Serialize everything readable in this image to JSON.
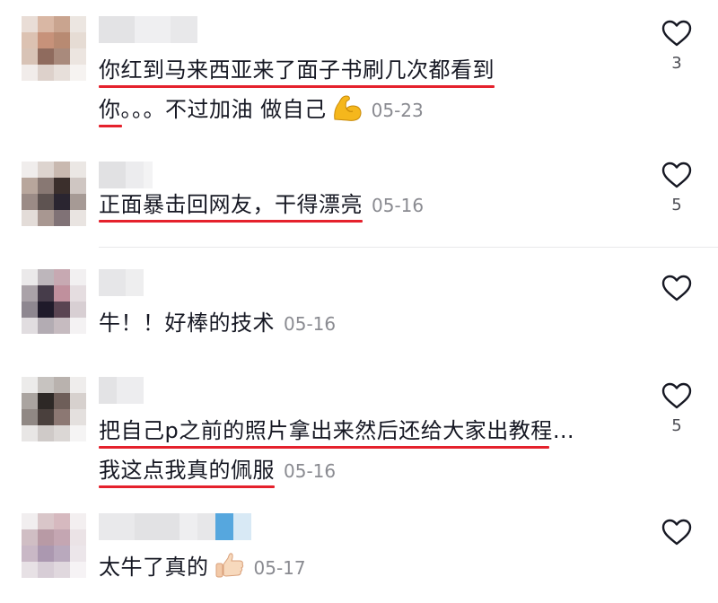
{
  "comments": [
    {
      "lines": [
        "你红到马来西亚来了面子书刷几次都看到",
        "你。。。不过加油 做自己"
      ],
      "date": "05-23",
      "emoji": "flexed-biceps",
      "likes": "3"
    },
    {
      "lines": [
        "正面暴击回网友，干得漂亮"
      ],
      "date": "05-16",
      "likes": "5"
    },
    {
      "lines": [
        "牛！！好棒的技术"
      ],
      "date": "05-16",
      "likes": ""
    },
    {
      "lines": [
        "把自己p之前的照片拿出来然后还给大家出教程…",
        "我这点我真的佩服"
      ],
      "date": "05-16",
      "likes": "5"
    },
    {
      "lines": [
        "太牛了真的"
      ],
      "date": "05-17",
      "emoji": "thumbs-up",
      "likes": ""
    }
  ],
  "colors": {
    "underline": "#e5212c",
    "date": "#8a8b91",
    "text": "#161823",
    "heart_stroke": "#161823"
  }
}
